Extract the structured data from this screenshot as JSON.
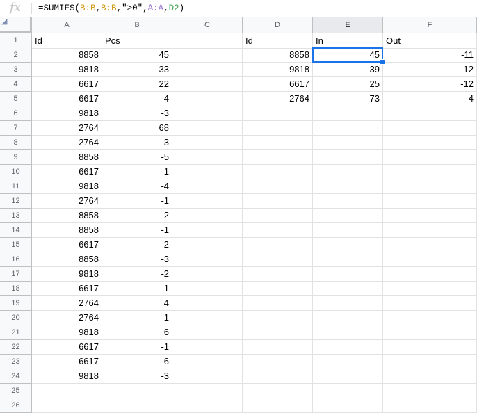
{
  "formula_bar": {
    "icon": "fx",
    "formula_parts": [
      "=SUMIFS(",
      "B:B",
      ",",
      "B:B",
      ",\">0\",",
      "A:A",
      ",",
      "D2",
      ")"
    ]
  },
  "columns": [
    "A",
    "B",
    "C",
    "D",
    "E",
    "F"
  ],
  "selected_column": "E",
  "rows": [
    "1",
    "2",
    "3",
    "4",
    "5",
    "6",
    "7",
    "8",
    "9",
    "10",
    "11",
    "12",
    "13",
    "14",
    "15",
    "16",
    "17",
    "18",
    "19",
    "20",
    "21",
    "22",
    "23",
    "24",
    "25",
    "26"
  ],
  "cells": [
    [
      "Id",
      "Pcs",
      "",
      "Id",
      "In",
      "Out"
    ],
    [
      "8858",
      "45",
      "",
      "8858",
      "45",
      "-11"
    ],
    [
      "9818",
      "33",
      "",
      "9818",
      "39",
      "-12"
    ],
    [
      "6617",
      "22",
      "",
      "6617",
      "25",
      "-12"
    ],
    [
      "6617",
      "-4",
      "",
      "2764",
      "73",
      "-4"
    ],
    [
      "9818",
      "-3",
      "",
      "",
      "",
      ""
    ],
    [
      "2764",
      "68",
      "",
      "",
      "",
      ""
    ],
    [
      "2764",
      "-3",
      "",
      "",
      "",
      ""
    ],
    [
      "8858",
      "-5",
      "",
      "",
      "",
      ""
    ],
    [
      "6617",
      "-1",
      "",
      "",
      "",
      ""
    ],
    [
      "9818",
      "-4",
      "",
      "",
      "",
      ""
    ],
    [
      "2764",
      "-1",
      "",
      "",
      "",
      ""
    ],
    [
      "8858",
      "-2",
      "",
      "",
      "",
      ""
    ],
    [
      "8858",
      "-1",
      "",
      "",
      "",
      ""
    ],
    [
      "6617",
      "2",
      "",
      "",
      "",
      ""
    ],
    [
      "8858",
      "-3",
      "",
      "",
      "",
      ""
    ],
    [
      "9818",
      "-2",
      "",
      "",
      "",
      ""
    ],
    [
      "6617",
      "1",
      "",
      "",
      "",
      ""
    ],
    [
      "2764",
      "4",
      "",
      "",
      "",
      ""
    ],
    [
      "2764",
      "1",
      "",
      "",
      "",
      ""
    ],
    [
      "9818",
      "6",
      "",
      "",
      "",
      ""
    ],
    [
      "6617",
      "-1",
      "",
      "",
      "",
      ""
    ],
    [
      "6617",
      "-6",
      "",
      "",
      "",
      ""
    ],
    [
      "9818",
      "-3",
      "",
      "",
      "",
      ""
    ],
    [
      "",
      "",
      "",
      "",
      "",
      ""
    ],
    [
      "",
      "",
      "",
      "",
      "",
      ""
    ]
  ],
  "selected_cell": "E2",
  "colors": {
    "selection": "#1a73e8",
    "ref_b": "#d59b1a",
    "ref_a": "#8e63ce",
    "ref_d": "#3aa34a"
  }
}
